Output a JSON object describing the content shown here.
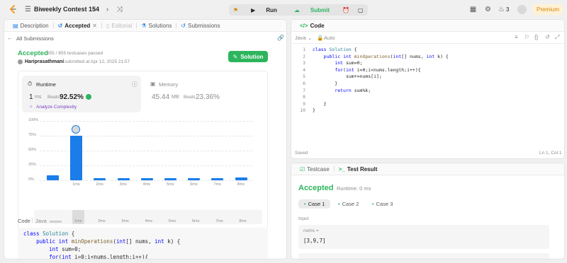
{
  "topbar": {
    "contest_title": "Biweekly Contest 154",
    "run_label": "Run",
    "submit_label": "Submit",
    "streak_count": "3",
    "premium_label": "Premium"
  },
  "left_panel": {
    "tabs": [
      {
        "label": "Description",
        "icon": "description-icon"
      },
      {
        "label": "Accepted",
        "icon": "history-icon"
      },
      {
        "label": "Editorial",
        "icon": "editorial-icon"
      },
      {
        "label": "Solutions",
        "icon": "flask-icon"
      },
      {
        "label": "Submissions",
        "icon": "history-icon"
      }
    ],
    "back_label": "All Submissions",
    "status": "Accepted",
    "testcases": "855 / 855 testcases passed",
    "username": "Hariprasathmani",
    "submitted_at": "submitted at Apr 12, 2025 21:57",
    "solution_button": "Solution",
    "runtime": {
      "title": "Runtime",
      "value": "1",
      "unit": "ms",
      "beats_label": "Beats",
      "beats_value": "92.52%",
      "analyze_label": "Analyze Complexity"
    },
    "memory": {
      "title": "Memory",
      "value": "45.44",
      "unit": "MB",
      "beats_label": "Beats",
      "beats_value": "23.36%"
    },
    "code_header": {
      "title": "Code",
      "language": "Java"
    }
  },
  "chart_data": {
    "type": "bar",
    "y_ticks": [
      "100%",
      "75%",
      "50%",
      "25%",
      "0%"
    ],
    "ylim": [
      0,
      100
    ],
    "categories": [
      "",
      "1ms",
      "2ms",
      "3ms",
      "4ms",
      "5ms",
      "6ms",
      "7ms",
      "8ms"
    ],
    "values": [
      8,
      75,
      3,
      3,
      3,
      3,
      3,
      3,
      5
    ],
    "highlight_index": 1,
    "minimap_labels": [
      "1ms",
      "2ms",
      "3ms",
      "4ms",
      "5ms",
      "6ms",
      "7ms",
      "8ms"
    ]
  },
  "code_preview": [
    "class Solution {",
    "    public int minOperations(int[] nums, int k) {",
    "        int sum=0;",
    "        for(int i=0;i<nums.length;i++){"
  ],
  "editor": {
    "title": "Code",
    "language": "Java",
    "mode": "Auto",
    "status": "Saved",
    "cursor": "Ln 1, Col 1",
    "lines": [
      "class Solution {",
      "    public int minOperations(int[] nums, int k) {",
      "        int sum=0;",
      "        for(int i=0;i<nums.length;i++){",
      "            sum+=nums[i];",
      "        }",
      "        return sum%k;",
      "",
      "    }",
      "}"
    ],
    "line_numbers": [
      "1",
      "2",
      "3",
      "4",
      "5",
      "6",
      "7",
      "8",
      "9",
      "10"
    ]
  },
  "result_panel": {
    "tab_testcase": "Testcase",
    "tab_result": "Test Result",
    "status": "Accepted",
    "runtime": "Runtime: 0 ms",
    "cases": [
      "Case 1",
      "Case 2",
      "Case 3"
    ],
    "input_label": "Input",
    "var_name": "nums =",
    "var_value": "[3,9,7]"
  },
  "colors": {
    "accent_green": "#2db55d",
    "bar_blue": "#1a7de9",
    "premium_gold": "#d48806"
  }
}
